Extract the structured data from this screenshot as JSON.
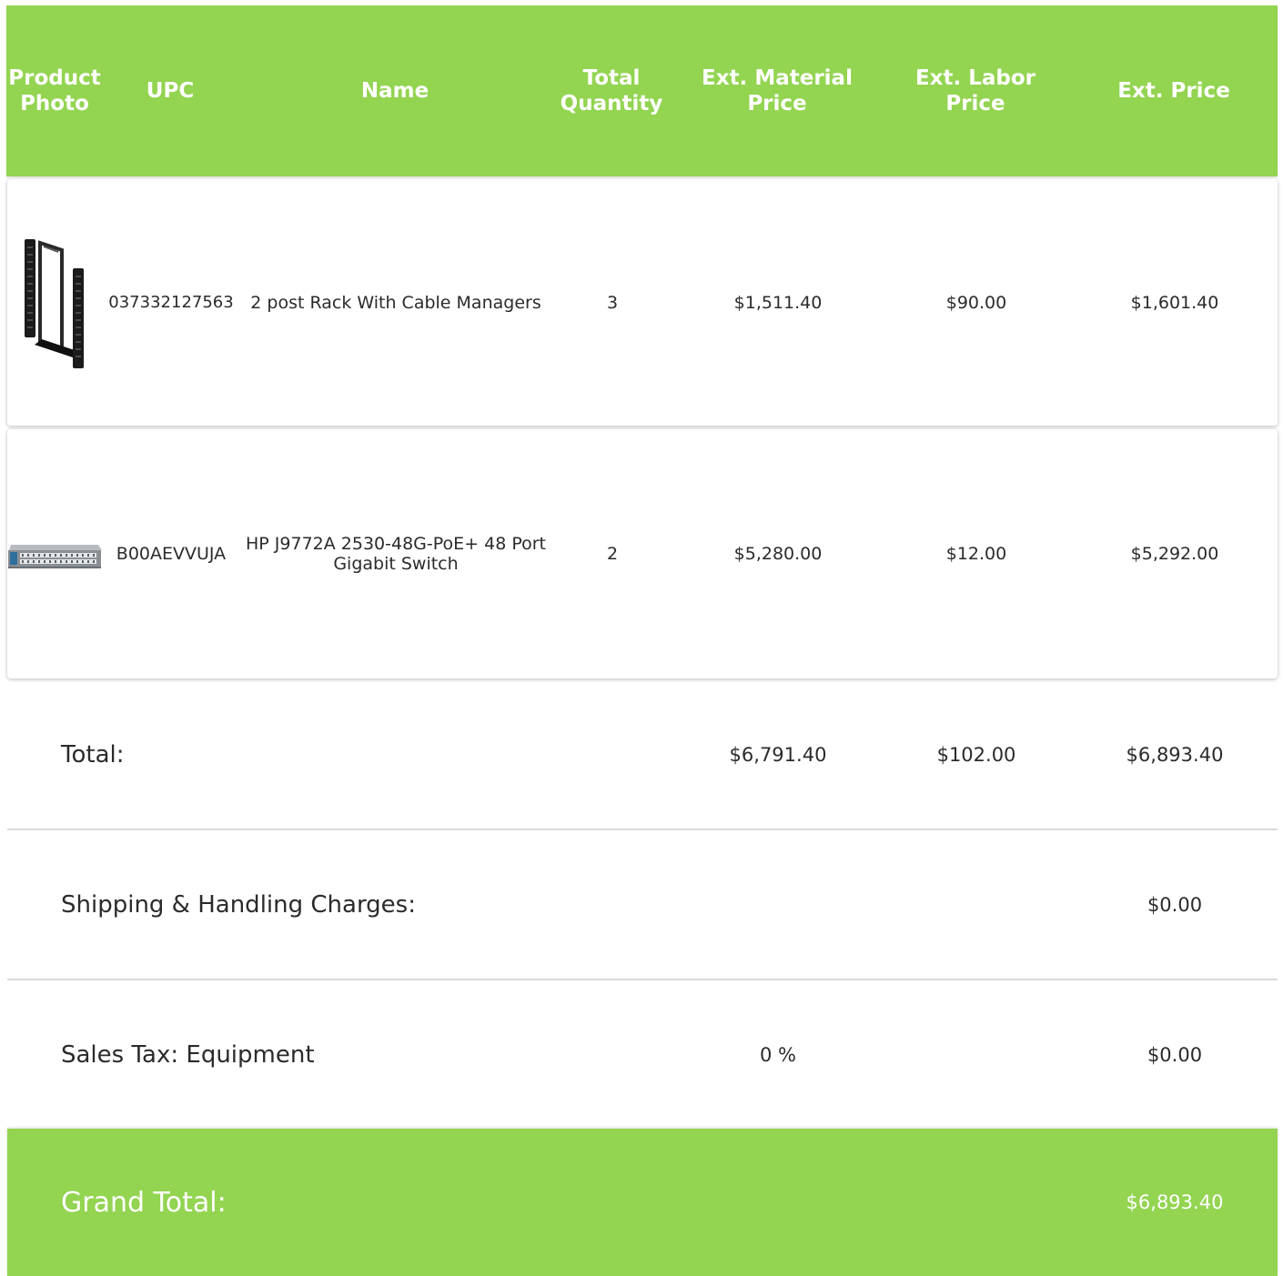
{
  "header": {
    "product_photo": "Product Photo",
    "upc": "UPC",
    "name": "Name",
    "total_quantity": "Total Quantity",
    "ext_material_price": "Ext. Material Price",
    "ext_labor_price": "Ext. Labor Price",
    "ext_price": "Ext. Price"
  },
  "rows": [
    {
      "photo_icon": "two-post-rack-photo",
      "upc": "037332127563",
      "name": "2 post Rack With Cable Managers",
      "quantity": "3",
      "material_price": "$1,511.40",
      "labor_price": "$90.00",
      "ext_price": "$1,601.40"
    },
    {
      "photo_icon": "network-switch-photo",
      "upc": "B00AEVVUJA",
      "name": "HP J9772A 2530-48G-PoE+ 48 Port Gigabit Switch",
      "quantity": "2",
      "material_price": "$5,280.00",
      "labor_price": "$12.00",
      "ext_price": "$5,292.00"
    }
  ],
  "summary": {
    "total_label": "Total:",
    "total_material": "$6,791.40",
    "total_labor": "$102.00",
    "total_price": "$6,893.40",
    "shipping_label": "Shipping & Handling Charges:",
    "shipping_value": "$0.00",
    "tax_label": "Sales Tax: Equipment",
    "tax_rate": "0 %",
    "tax_value": "$0.00",
    "grand_total_label": "Grand Total:",
    "grand_total_value": "$6,893.40"
  },
  "colors": {
    "accent_green": "#93d451",
    "text": "#2b2b2b",
    "divider": "#dadada"
  }
}
